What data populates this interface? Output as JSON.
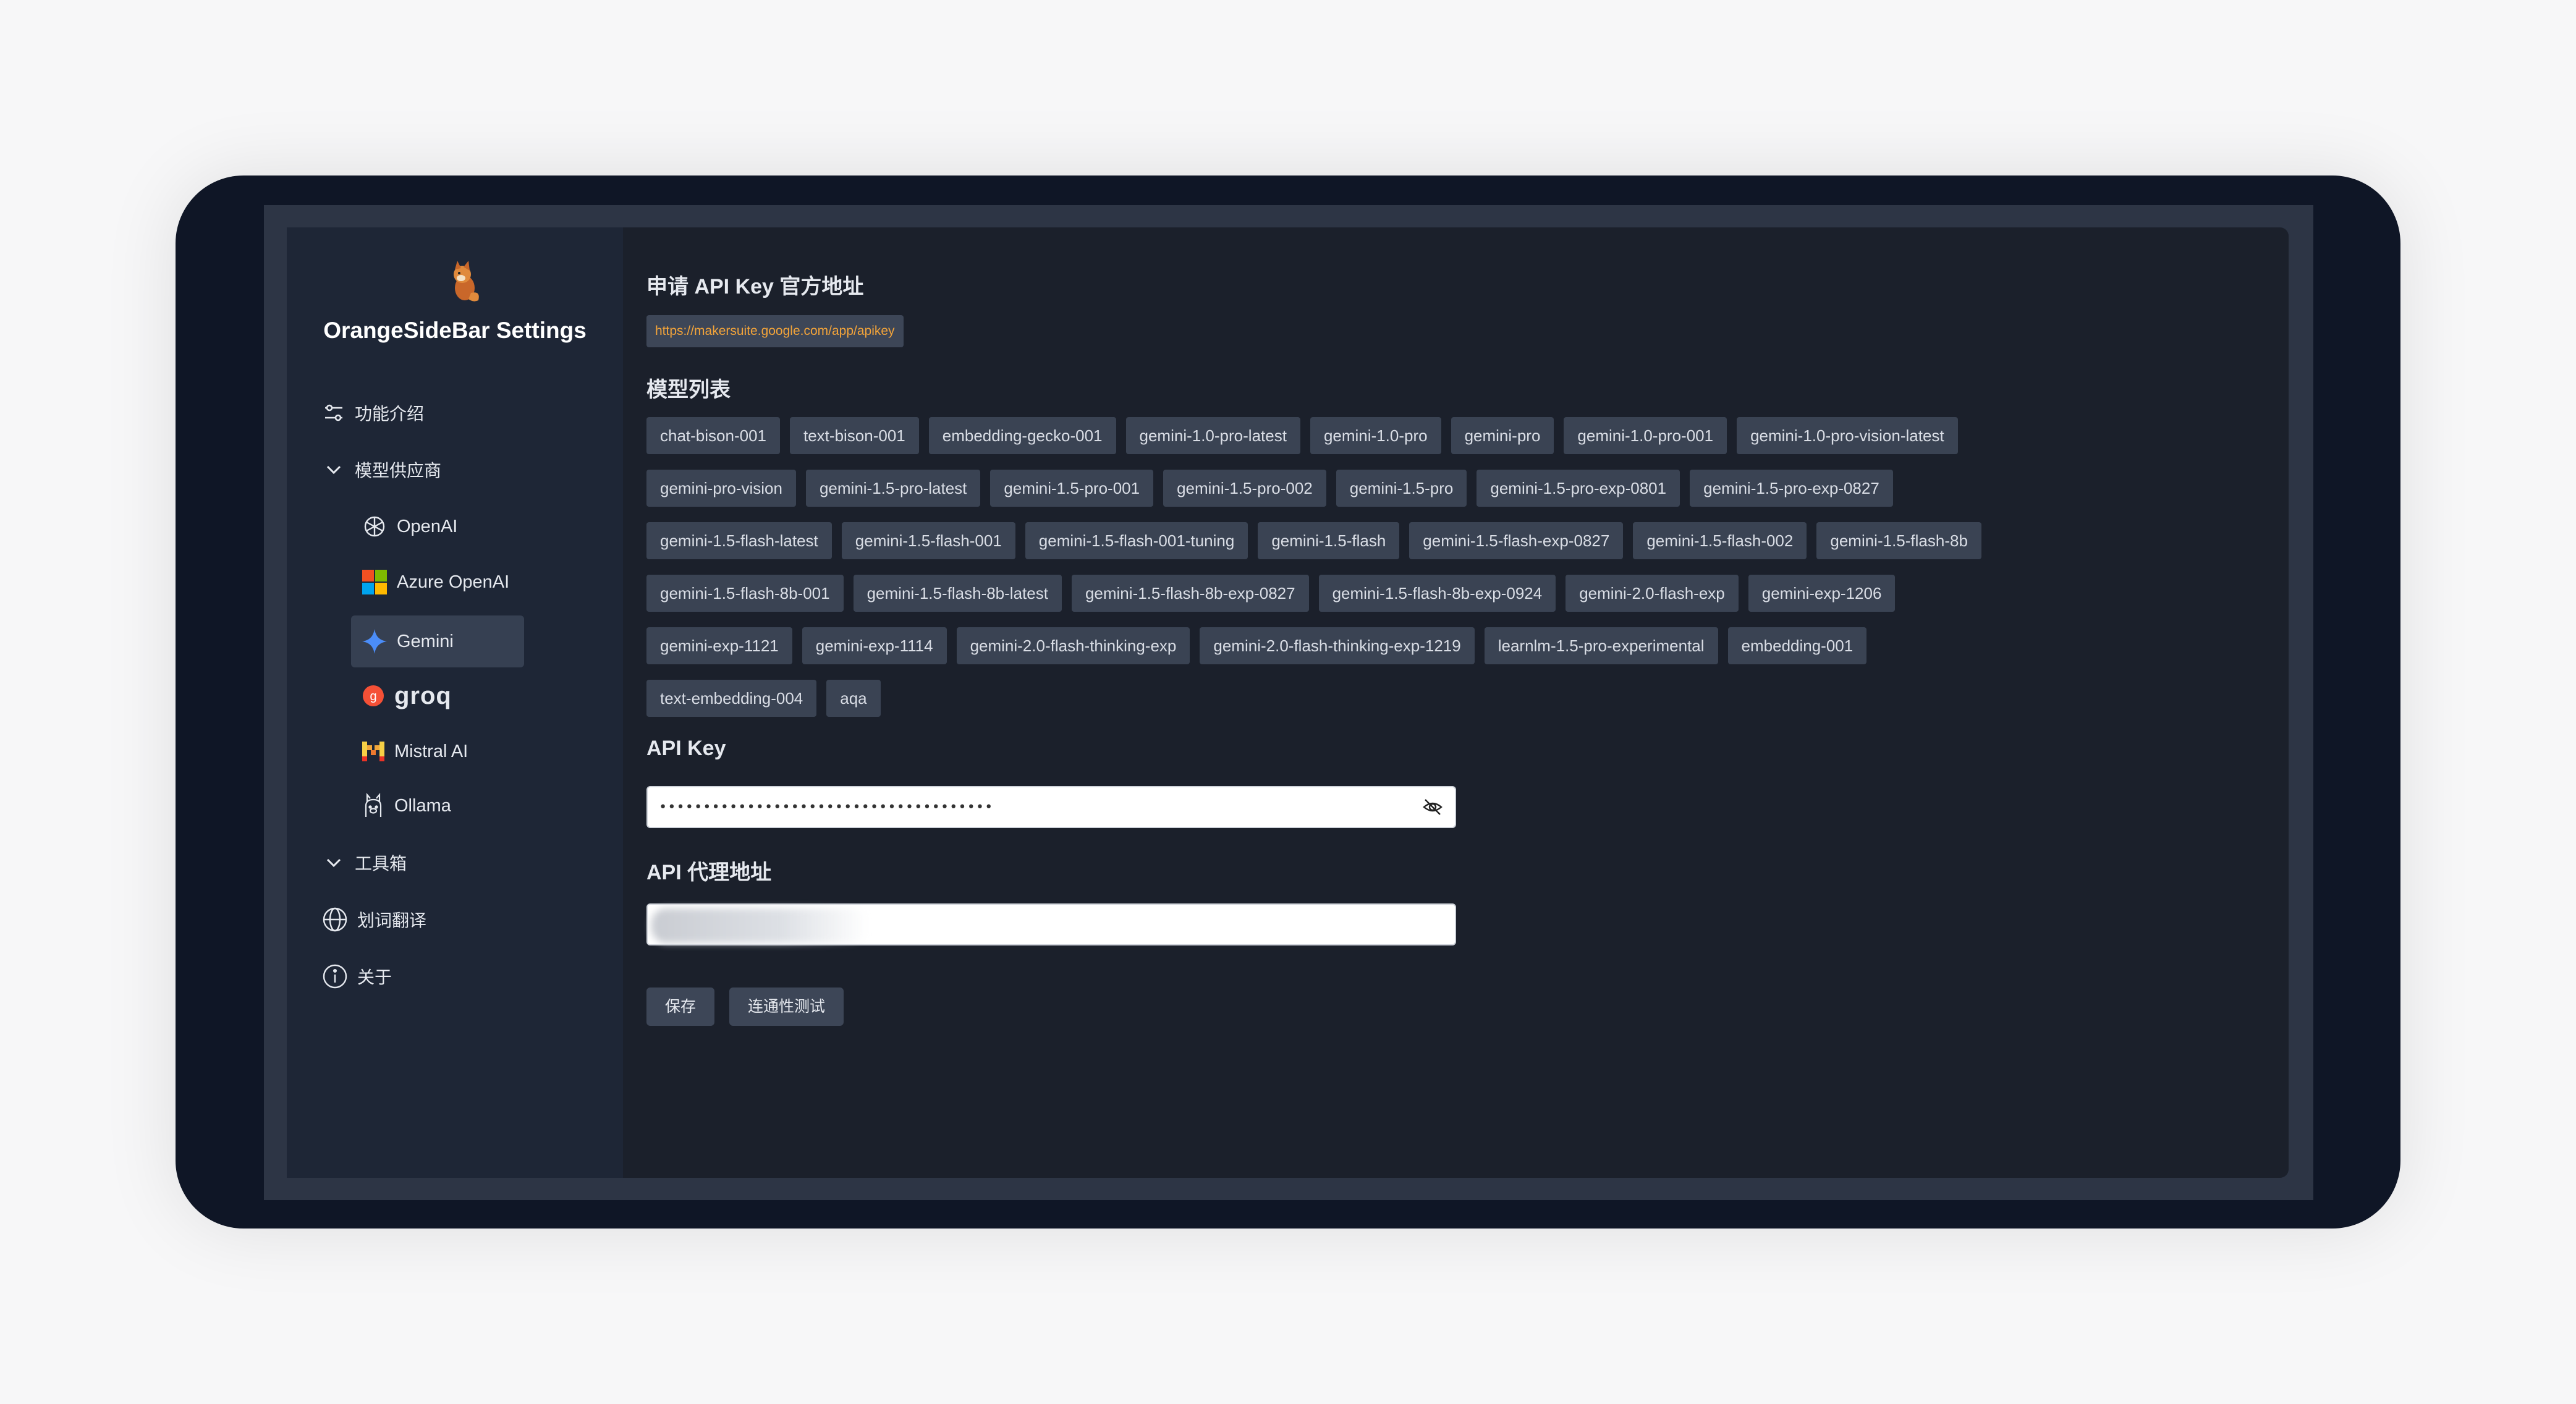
{
  "app": {
    "title": "OrangeSideBar Settings"
  },
  "sidebar": {
    "items": [
      {
        "label": "功能介绍",
        "icon": "sliders-icon"
      },
      {
        "label": "模型供应商",
        "icon": "chevron-down-icon"
      },
      {
        "label": "工具箱",
        "icon": "chevron-down-icon"
      },
      {
        "label": "划词翻译",
        "icon": "globe-icon"
      },
      {
        "label": "关于",
        "icon": "info-icon"
      }
    ],
    "providers": [
      {
        "label": "OpenAI",
        "icon": "openai-icon"
      },
      {
        "label": "Azure OpenAI",
        "icon": "microsoft-icon"
      },
      {
        "label": "Gemini",
        "icon": "gemini-icon",
        "active": true
      },
      {
        "label": "groq",
        "icon": "groq-icon"
      },
      {
        "label": "Mistral AI",
        "icon": "mistral-icon"
      },
      {
        "label": "Ollama",
        "icon": "ollama-icon"
      }
    ]
  },
  "main": {
    "apikey_section_title": "申请 API Key 官方地址",
    "apikey_url": "https://makersuite.google.com/app/apikey",
    "models_title": "模型列表",
    "models": [
      "chat-bison-001",
      "text-bison-001",
      "embedding-gecko-001",
      "gemini-1.0-pro-latest",
      "gemini-1.0-pro",
      "gemini-pro",
      "gemini-1.0-pro-001",
      "gemini-1.0-pro-vision-latest",
      "gemini-pro-vision",
      "gemini-1.5-pro-latest",
      "gemini-1.5-pro-001",
      "gemini-1.5-pro-002",
      "gemini-1.5-pro",
      "gemini-1.5-pro-exp-0801",
      "gemini-1.5-pro-exp-0827",
      "gemini-1.5-flash-latest",
      "gemini-1.5-flash-001",
      "gemini-1.5-flash-001-tuning",
      "gemini-1.5-flash",
      "gemini-1.5-flash-exp-0827",
      "gemini-1.5-flash-002",
      "gemini-1.5-flash-8b",
      "gemini-1.5-flash-8b-001",
      "gemini-1.5-flash-8b-latest",
      "gemini-1.5-flash-8b-exp-0827",
      "gemini-1.5-flash-8b-exp-0924",
      "gemini-2.0-flash-exp",
      "gemini-exp-1206",
      "gemini-exp-1121",
      "gemini-exp-1114",
      "gemini-2.0-flash-thinking-exp",
      "gemini-2.0-flash-thinking-exp-1219",
      "learnlm-1.5-pro-experimental",
      "embedding-001",
      "text-embedding-004",
      "aqa"
    ],
    "api_key_label": "API Key",
    "api_key_value": "••••••••••••••••••••••••••••••••••••••",
    "proxy_label": "API 代理地址",
    "proxy_value": "",
    "save_label": "保存",
    "test_label": "连通性测试"
  },
  "colors": {
    "accent_link": "#f3a43a",
    "sidebar_bg": "#1e2636",
    "main_bg": "#1b202b"
  }
}
